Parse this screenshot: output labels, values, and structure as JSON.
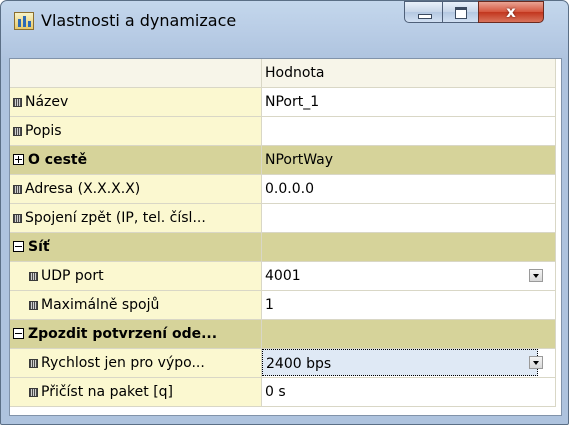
{
  "window": {
    "title": "Vlastnosti a dynamizace",
    "close_label": "x"
  },
  "grid": {
    "header": {
      "name": "",
      "value": "Hodnota"
    },
    "rows": [
      {
        "name": "Název",
        "value": "NPort_1"
      },
      {
        "name": "Popis",
        "value": ""
      },
      {
        "name": "O cestě",
        "value": "NPortWay"
      },
      {
        "name": "Adresa (X.X.X.X)",
        "value": "0.0.0.0"
      },
      {
        "name": "Spojení zpět (IP, tel. čísl...",
        "value": ""
      },
      {
        "name": "Síť",
        "value": ""
      },
      {
        "name": "UDP port",
        "value": "4001"
      },
      {
        "name": "Maximálně spojů",
        "value": "1"
      },
      {
        "name": "Zpozdit potvrzení ode...",
        "value": ""
      },
      {
        "name": "Rychlost jen pro výpo...",
        "value": "2400 bps"
      },
      {
        "name": "Přičíst na paket [q]",
        "value": "0 s"
      }
    ]
  }
}
